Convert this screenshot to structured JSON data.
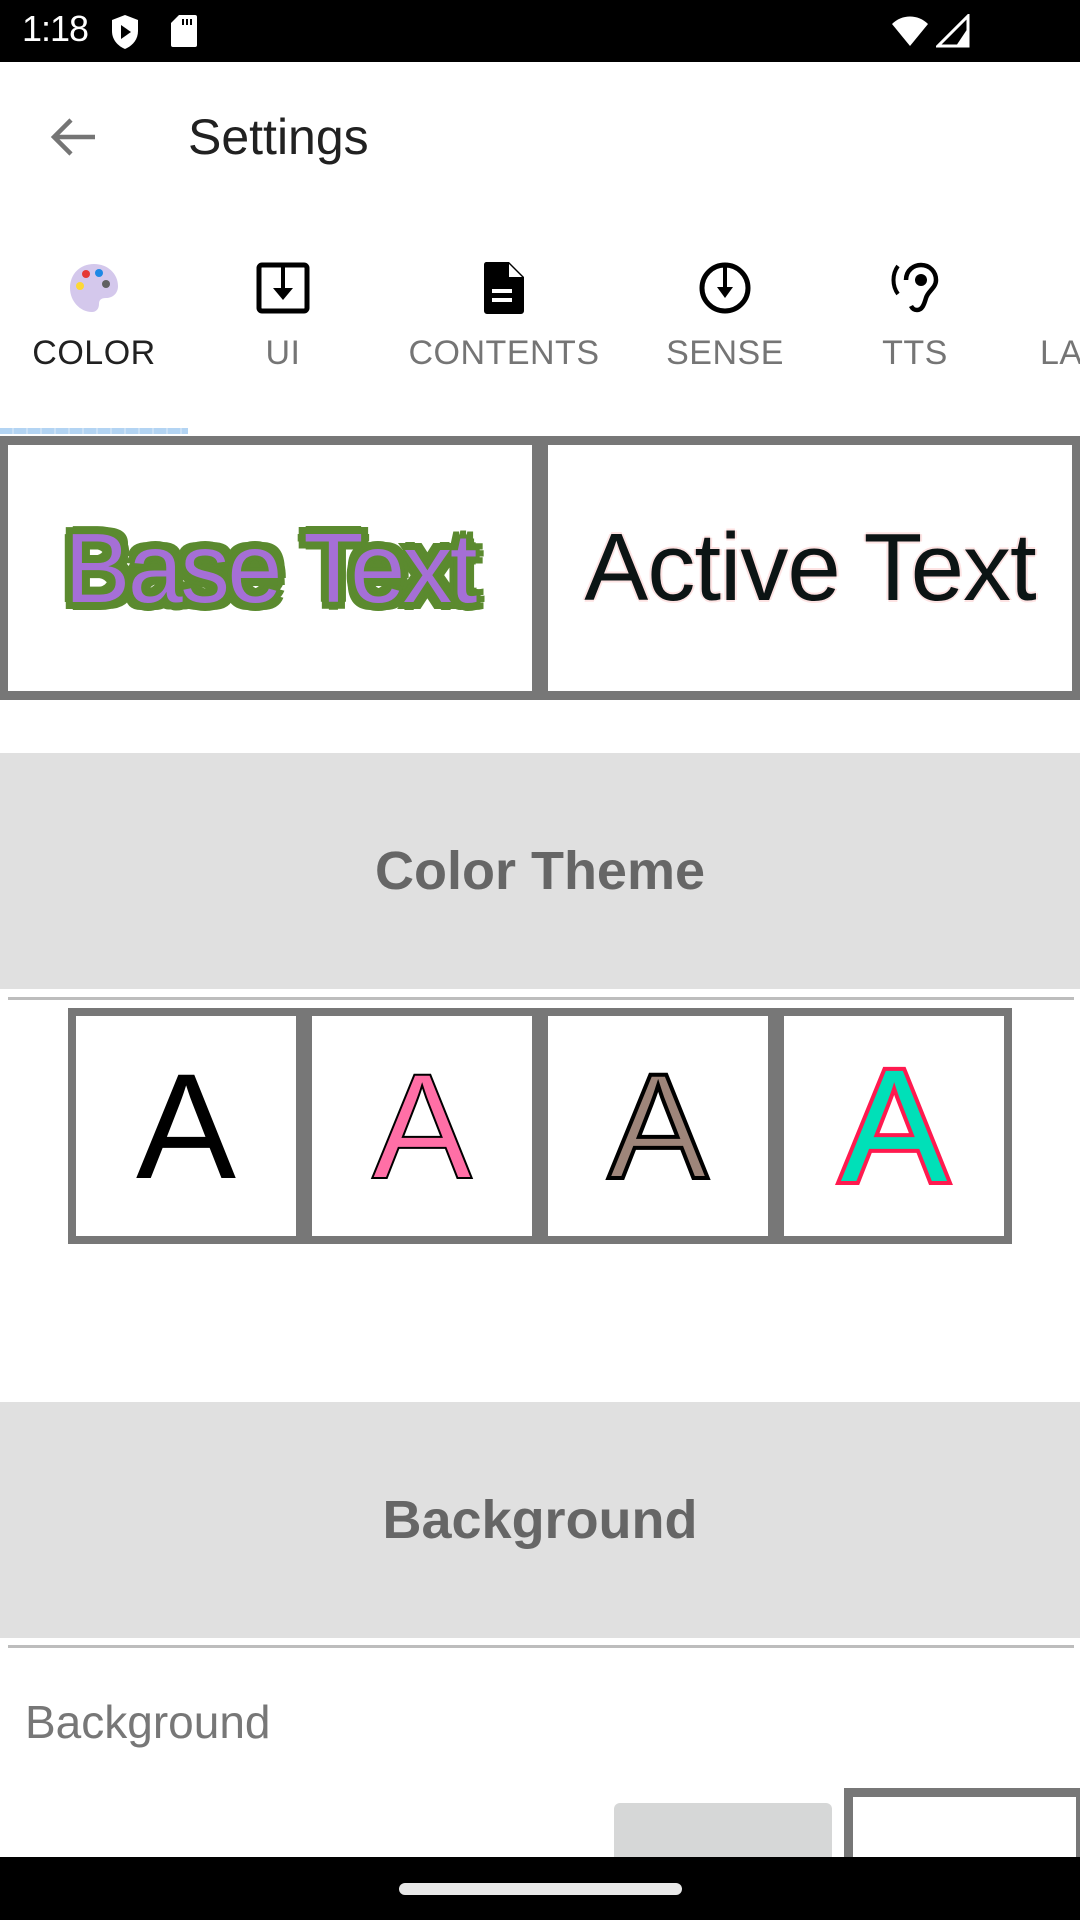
{
  "status_bar": {
    "time": "1:18",
    "left_icons": [
      "shield-play-icon",
      "sd-card-icon"
    ],
    "right_icons": [
      "wifi-icon",
      "cell-signal-icon"
    ]
  },
  "app_bar": {
    "back_icon": "arrow-back-icon",
    "title": "Settings"
  },
  "tabs": {
    "active_index": 0,
    "items": [
      {
        "label": "COLOR",
        "icon": "palette-icon"
      },
      {
        "label": "UI",
        "icon": "download-box-icon"
      },
      {
        "label": "CONTENTS",
        "icon": "document-icon"
      },
      {
        "label": "SENSE",
        "icon": "download-circle-icon"
      },
      {
        "label": "TTS",
        "icon": "hearing-icon"
      },
      {
        "label": "LA",
        "icon": ""
      }
    ]
  },
  "preview": {
    "base_text": "Base Text",
    "active_text": "Active Text",
    "base_fill_color": "#a56fd6",
    "base_outline_color": "#5b8a2f",
    "active_fill_color": "#0c1414",
    "active_outline_color": "#fde3e3"
  },
  "sections": {
    "color_theme": {
      "title": "Color Theme"
    },
    "background": {
      "title": "Background"
    }
  },
  "color_themes": [
    {
      "glyph": "A",
      "fill": "#000000",
      "outline": "none"
    },
    {
      "glyph": "A",
      "fill": "#ff6fa6",
      "outline": "#000000"
    },
    {
      "glyph": "A",
      "fill": "#9e857a",
      "outline": "#000000"
    },
    {
      "glyph": "A",
      "fill": "#00e0b8",
      "outline": "#ff1a4f"
    }
  ],
  "background_option": {
    "label": "Background",
    "swatches": [
      "#d6d7d7",
      "#ffffff"
    ]
  }
}
